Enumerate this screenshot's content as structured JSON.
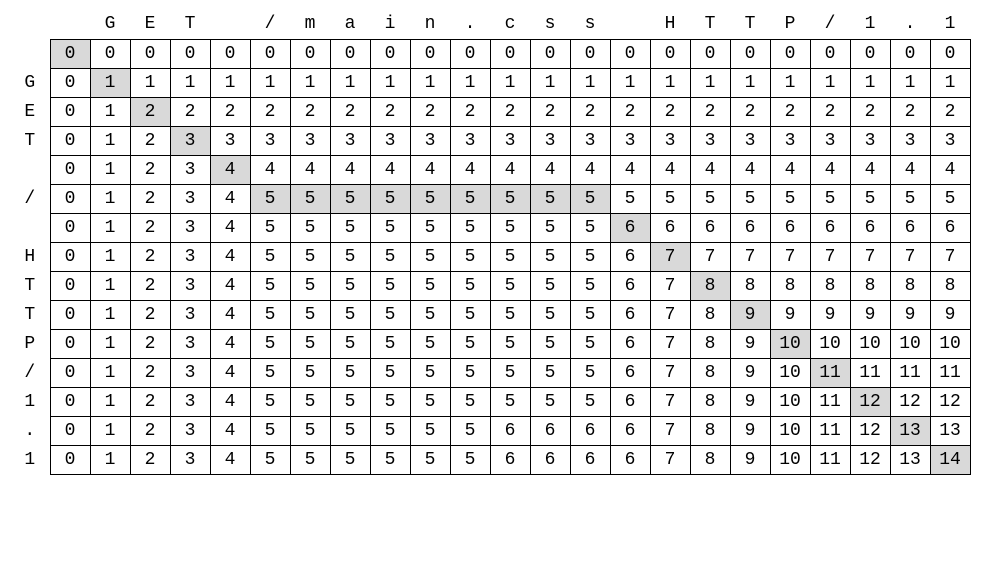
{
  "col_labels": [
    "",
    "G",
    "E",
    "T",
    "",
    "/",
    "m",
    "a",
    "i",
    "n",
    ".",
    "c",
    "s",
    "s",
    "",
    "H",
    "T",
    "T",
    "P",
    "/",
    "1",
    ".",
    "1"
  ],
  "row_labels": [
    "",
    "G",
    "E",
    "T",
    "",
    "/",
    "",
    "H",
    "T",
    "T",
    "P",
    "/",
    "1",
    ".",
    "1"
  ],
  "grid": [
    [
      0,
      0,
      0,
      0,
      0,
      0,
      0,
      0,
      0,
      0,
      0,
      0,
      0,
      0,
      0,
      0,
      0,
      0,
      0,
      0,
      0,
      0,
      0
    ],
    [
      0,
      1,
      1,
      1,
      1,
      1,
      1,
      1,
      1,
      1,
      1,
      1,
      1,
      1,
      1,
      1,
      1,
      1,
      1,
      1,
      1,
      1,
      1
    ],
    [
      0,
      1,
      2,
      2,
      2,
      2,
      2,
      2,
      2,
      2,
      2,
      2,
      2,
      2,
      2,
      2,
      2,
      2,
      2,
      2,
      2,
      2,
      2
    ],
    [
      0,
      1,
      2,
      3,
      3,
      3,
      3,
      3,
      3,
      3,
      3,
      3,
      3,
      3,
      3,
      3,
      3,
      3,
      3,
      3,
      3,
      3,
      3
    ],
    [
      0,
      1,
      2,
      3,
      4,
      4,
      4,
      4,
      4,
      4,
      4,
      4,
      4,
      4,
      4,
      4,
      4,
      4,
      4,
      4,
      4,
      4,
      4
    ],
    [
      0,
      1,
      2,
      3,
      4,
      5,
      5,
      5,
      5,
      5,
      5,
      5,
      5,
      5,
      5,
      5,
      5,
      5,
      5,
      5,
      5,
      5,
      5
    ],
    [
      0,
      1,
      2,
      3,
      4,
      5,
      5,
      5,
      5,
      5,
      5,
      5,
      5,
      5,
      6,
      6,
      6,
      6,
      6,
      6,
      6,
      6,
      6
    ],
    [
      0,
      1,
      2,
      3,
      4,
      5,
      5,
      5,
      5,
      5,
      5,
      5,
      5,
      5,
      6,
      7,
      7,
      7,
      7,
      7,
      7,
      7,
      7
    ],
    [
      0,
      1,
      2,
      3,
      4,
      5,
      5,
      5,
      5,
      5,
      5,
      5,
      5,
      5,
      6,
      7,
      8,
      8,
      8,
      8,
      8,
      8,
      8
    ],
    [
      0,
      1,
      2,
      3,
      4,
      5,
      5,
      5,
      5,
      5,
      5,
      5,
      5,
      5,
      6,
      7,
      8,
      9,
      9,
      9,
      9,
      9,
      9
    ],
    [
      0,
      1,
      2,
      3,
      4,
      5,
      5,
      5,
      5,
      5,
      5,
      5,
      5,
      5,
      6,
      7,
      8,
      9,
      10,
      10,
      10,
      10,
      10
    ],
    [
      0,
      1,
      2,
      3,
      4,
      5,
      5,
      5,
      5,
      5,
      5,
      5,
      5,
      5,
      6,
      7,
      8,
      9,
      10,
      11,
      11,
      11,
      11
    ],
    [
      0,
      1,
      2,
      3,
      4,
      5,
      5,
      5,
      5,
      5,
      5,
      5,
      5,
      5,
      6,
      7,
      8,
      9,
      10,
      11,
      12,
      12,
      12
    ],
    [
      0,
      1,
      2,
      3,
      4,
      5,
      5,
      5,
      5,
      5,
      5,
      6,
      6,
      6,
      6,
      7,
      8,
      9,
      10,
      11,
      12,
      13,
      13
    ],
    [
      0,
      1,
      2,
      3,
      4,
      5,
      5,
      5,
      5,
      5,
      5,
      6,
      6,
      6,
      6,
      7,
      8,
      9,
      10,
      11,
      12,
      13,
      14
    ]
  ],
  "highlights": [
    [
      0,
      0
    ],
    [
      1,
      1
    ],
    [
      2,
      2
    ],
    [
      3,
      3
    ],
    [
      4,
      4
    ],
    [
      5,
      5
    ],
    [
      5,
      6
    ],
    [
      5,
      7
    ],
    [
      5,
      8
    ],
    [
      5,
      9
    ],
    [
      5,
      10
    ],
    [
      5,
      11
    ],
    [
      5,
      12
    ],
    [
      5,
      13
    ],
    [
      6,
      14
    ],
    [
      7,
      15
    ],
    [
      8,
      16
    ],
    [
      9,
      17
    ],
    [
      10,
      18
    ],
    [
      11,
      19
    ],
    [
      12,
      20
    ],
    [
      13,
      21
    ],
    [
      14,
      22
    ]
  ],
  "chart_data": {
    "type": "table",
    "description": "Longest Common Subsequence dynamic-programming matrix",
    "string_top": "GET /main.css HTTP/1.1",
    "string_left": "GET / HTTP/1.1",
    "lcs_length": 14
  }
}
